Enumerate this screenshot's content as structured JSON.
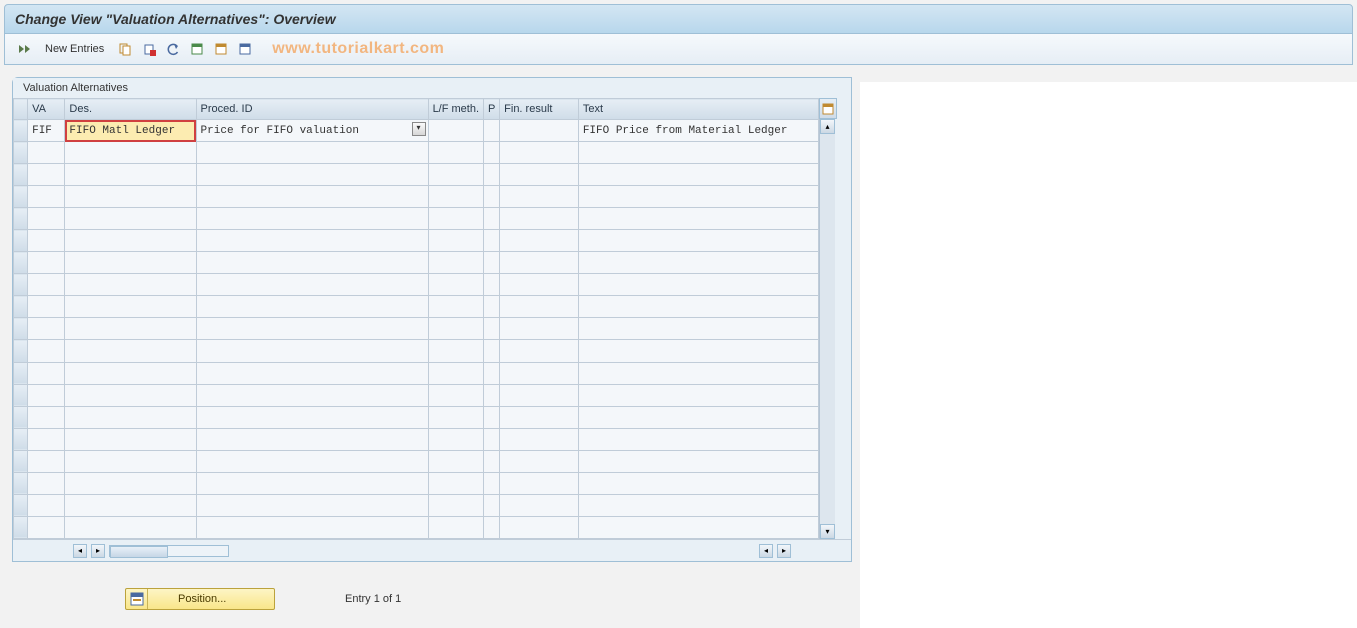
{
  "title": "Change View \"Valuation Alternatives\": Overview",
  "toolbar": {
    "new_entries_label": "New Entries"
  },
  "watermark": "www.tutorialkart.com",
  "panel": {
    "title": "Valuation Alternatives",
    "columns": {
      "va": "VA",
      "des": "Des.",
      "proc": "Proced. ID",
      "lf": "L/F meth.",
      "p": "P",
      "fin": "Fin. result",
      "text": "Text"
    },
    "rows": [
      {
        "va": "FIF",
        "des": "FIFO Matl Ledger",
        "proc": "Price for FIFO valuation",
        "lf": "",
        "p": "",
        "fin": "",
        "text": "FIFO Price from Material Ledger"
      }
    ]
  },
  "footer": {
    "position_label": "Position...",
    "entry_text": "Entry 1 of 1"
  }
}
